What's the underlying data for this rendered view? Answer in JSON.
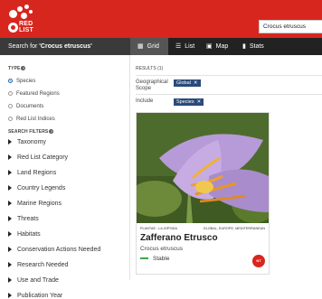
{
  "header": {
    "logo_text_line1": "RED",
    "logo_text_line2": "LIST",
    "search_value": "Crocus etruscus"
  },
  "subbar": {
    "search_for_prefix": "Search for ",
    "search_for_term": "'Crocus etruscus'",
    "tabs": [
      {
        "label": "Grid",
        "icon": "grid-icon"
      },
      {
        "label": "List",
        "icon": "list-icon"
      },
      {
        "label": "Map",
        "icon": "map-icon"
      },
      {
        "label": "Stats",
        "icon": "stats-icon"
      }
    ]
  },
  "sidebar": {
    "type_title": "TYPE",
    "type_options": [
      "Species",
      "Featured Regions",
      "Documents",
      "Red List Indices"
    ],
    "type_selected": "Species",
    "filters_title": "SEARCH FILTERS",
    "filters": [
      "Taxonomy",
      "Red List Category",
      "Land Regions",
      "Country Legends",
      "Marine Regions",
      "Threats",
      "Habitats",
      "Conservation Actions Needed",
      "Research Needed",
      "Use and Trade",
      "Publication Year"
    ]
  },
  "main": {
    "results_label": "RESULTS (1)",
    "scope_label_line1": "Geographical",
    "scope_label_line2": "Scope",
    "scope_chip": "Global",
    "include_label": "Include",
    "include_chip": "Species",
    "chip_remove": "✕"
  },
  "card": {
    "kingdom": "PLANTAE - LILIOPSIDA",
    "scope": "GLOBAL, EUROPE, MEDITERRANEAN",
    "common_name": "Zafferano Etrusco",
    "scientific_name": "Crocus etruscus",
    "trend": "Stable",
    "category": "NT",
    "colors": {
      "trend": "#3aa84a",
      "badge": "#d7261e",
      "brand": "#d7261e"
    }
  }
}
